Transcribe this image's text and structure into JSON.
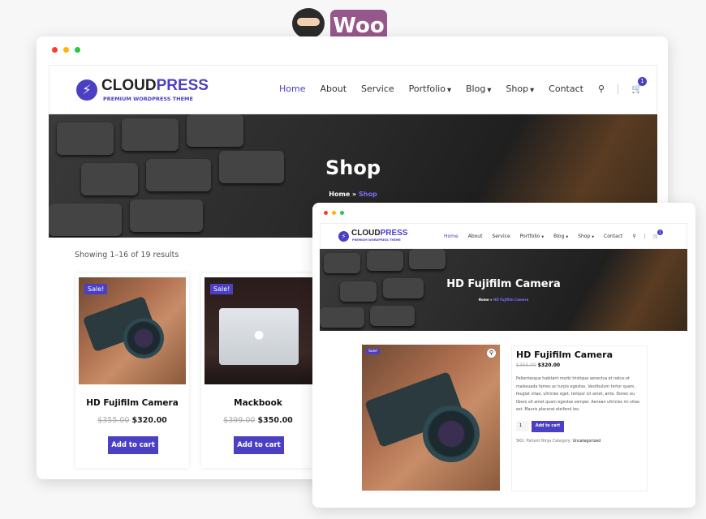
{
  "badge": {
    "woo_logo": "Woo",
    "mascot": "ninja"
  },
  "colors": {
    "accent": "#4b3fc4",
    "woo": "#96588a",
    "dot_red": "#ff3b30",
    "dot_yellow": "#ffb400",
    "dot_green": "#28c840"
  },
  "brand": {
    "name_a": "CLOUD",
    "name_b": "PRESS",
    "tagline": "PREMIUM WORDPRESS THEME",
    "icon": "lightning-bolt-icon"
  },
  "nav": {
    "items": [
      {
        "label": "Home",
        "active": true
      },
      {
        "label": "About"
      },
      {
        "label": "Service"
      },
      {
        "label": "Portfolio",
        "dropdown": true
      },
      {
        "label": "Blog",
        "dropdown": true
      },
      {
        "label": "Shop",
        "dropdown": true
      },
      {
        "label": "Contact"
      }
    ],
    "search_icon": "search-icon",
    "cart_icon": "cart-icon",
    "cart_count": "1"
  },
  "shop": {
    "title": "Shop",
    "breadcrumb_home": "Home",
    "breadcrumb_sep": "»",
    "breadcrumb_current": "Shop",
    "result_count": "Showing 1–16 of 19 results",
    "products": [
      {
        "name": "HD Fujifilm Camera",
        "badge": "Sale!",
        "old_price": "$355.00",
        "price": "$320.00",
        "button": "Add to cart"
      },
      {
        "name": "Mackbook",
        "badge": "Sale!",
        "old_price": "$399.00",
        "price": "$350.00",
        "button": "Add to cart"
      }
    ]
  },
  "product": {
    "title": "HD Fujifilm Camera",
    "breadcrumb_home": "Home",
    "breadcrumb_sep": "»",
    "breadcrumb_current": "HD Fujifilm Camera",
    "badge": "Sale!",
    "old_price": "$355.00",
    "price": "$320.00",
    "description": "Pellentesque habitant morbi tristique senectus et netus et malesuada fames ac turpis egestas. Vestibulum tortor quam, feugiat vitae, ultricies eget, tempor sit amet, ante. Donec eu libero sit amet quam egestas semper. Aenean ultricies mi vitae est. Mauris placerat eleifend leo.",
    "quantity": "1",
    "button": "Add to cart",
    "sku_label": "SKU:",
    "sku": "Patient Ninja",
    "category_label": "Category:",
    "category": "Uncategorized",
    "zoom_icon": "magnifier-icon"
  }
}
